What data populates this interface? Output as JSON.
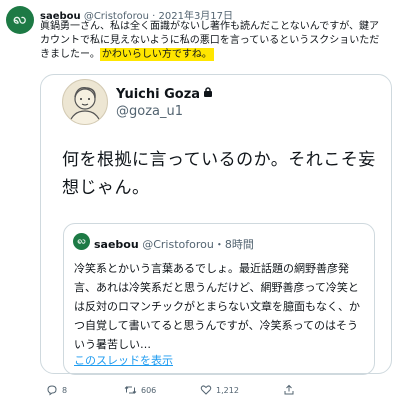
{
  "post": {
    "display_name": "saebou",
    "handle": "@Cristoforou",
    "separator": "·",
    "date": "2021年3月17日",
    "text_line1": "眞鍋勇一さん、私は全く面識がないし著作も読んだことないんですが、鍵ア",
    "text_line2": "カウントで私に見えないように私の悪口を言っているというスクショいただ",
    "text_line3": "きましたー。",
    "highlight": "かわいらしい方ですね。",
    "highlight_color": "#ffe600"
  },
  "screenshot": {
    "name": "Yuichi Goza",
    "handle": "@goza_u1",
    "text": "何を根拠に言っているのか。それこそ妄想じゃん。",
    "quoted": {
      "name": "saebou",
      "handle": "@Cristoforou",
      "time": "・8時間",
      "text": "冷笑系とかいう言葉あるでしょ。最近話題の網野善彦発言、あれは冷笑系だと思うんだけど、網野善彦って冷笑とは反対のロマンチックがとまらない文章を臆面もなく、かつ自覚して書いてると思うんですが、冷笑系ってのはそういう暑苦しい…",
      "thread_link": "このスレッドを表示"
    }
  },
  "actions": {
    "replies": "8",
    "retweets": "606",
    "likes": "1,212"
  },
  "colors": {
    "link": "#1d9bf0",
    "muted": "#536471",
    "avatar": "#1d7a45"
  },
  "icons": [
    "reply-icon",
    "retweet-icon",
    "like-icon",
    "share-icon",
    "lock-icon"
  ]
}
